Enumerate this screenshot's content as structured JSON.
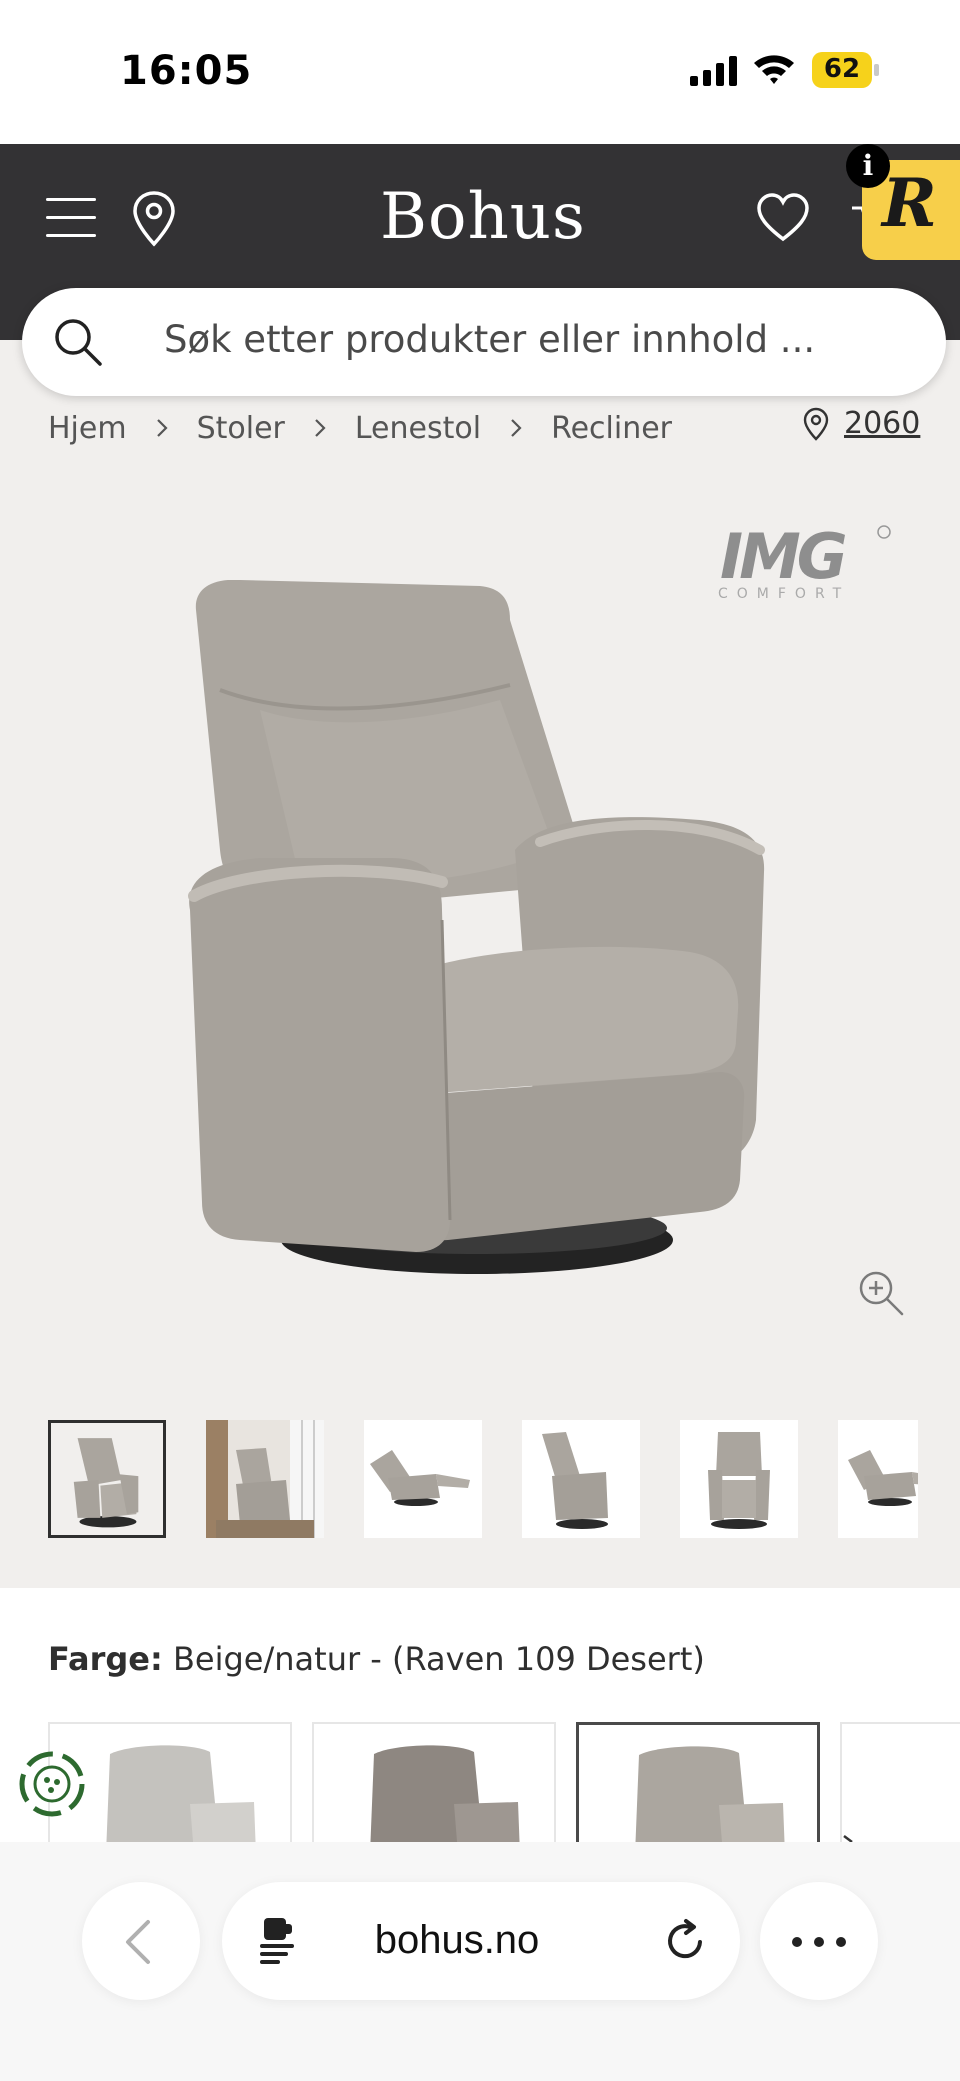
{
  "status_bar": {
    "time": "16:05",
    "battery": "62"
  },
  "header": {
    "logo": "Bohus",
    "r_badge_letter": "R",
    "info_label": "i"
  },
  "search": {
    "placeholder": "Søk etter produkter eller innhold ..."
  },
  "breadcrumb": {
    "items": [
      "Hjem",
      "Stoler",
      "Lenestol",
      "Recliner"
    ],
    "postcode": "2060"
  },
  "product": {
    "brand_logo": "IMG COMFORT",
    "color_label": "Farge:",
    "color_value": "Beige/natur - (Raven 109 Desert)",
    "thumbnail_count": 6,
    "selected_thumbnail": 1,
    "selected_swatch": 3
  },
  "browser": {
    "url": "bohus.no"
  },
  "colors": {
    "header_bg": "#333234",
    "page_gray": "#f1efed",
    "battery_yellow": "#f6d21b",
    "r_badge_yellow": "#f7cf4a",
    "chair_fabric": "#a9a49d"
  },
  "icons": [
    "menu-icon",
    "location-pin-icon",
    "heart-icon",
    "search-icon",
    "chevron-right-icon",
    "zoom-in-icon",
    "back-arrow-icon",
    "reader-icon",
    "reload-icon",
    "more-icon",
    "cookie-icon"
  ]
}
